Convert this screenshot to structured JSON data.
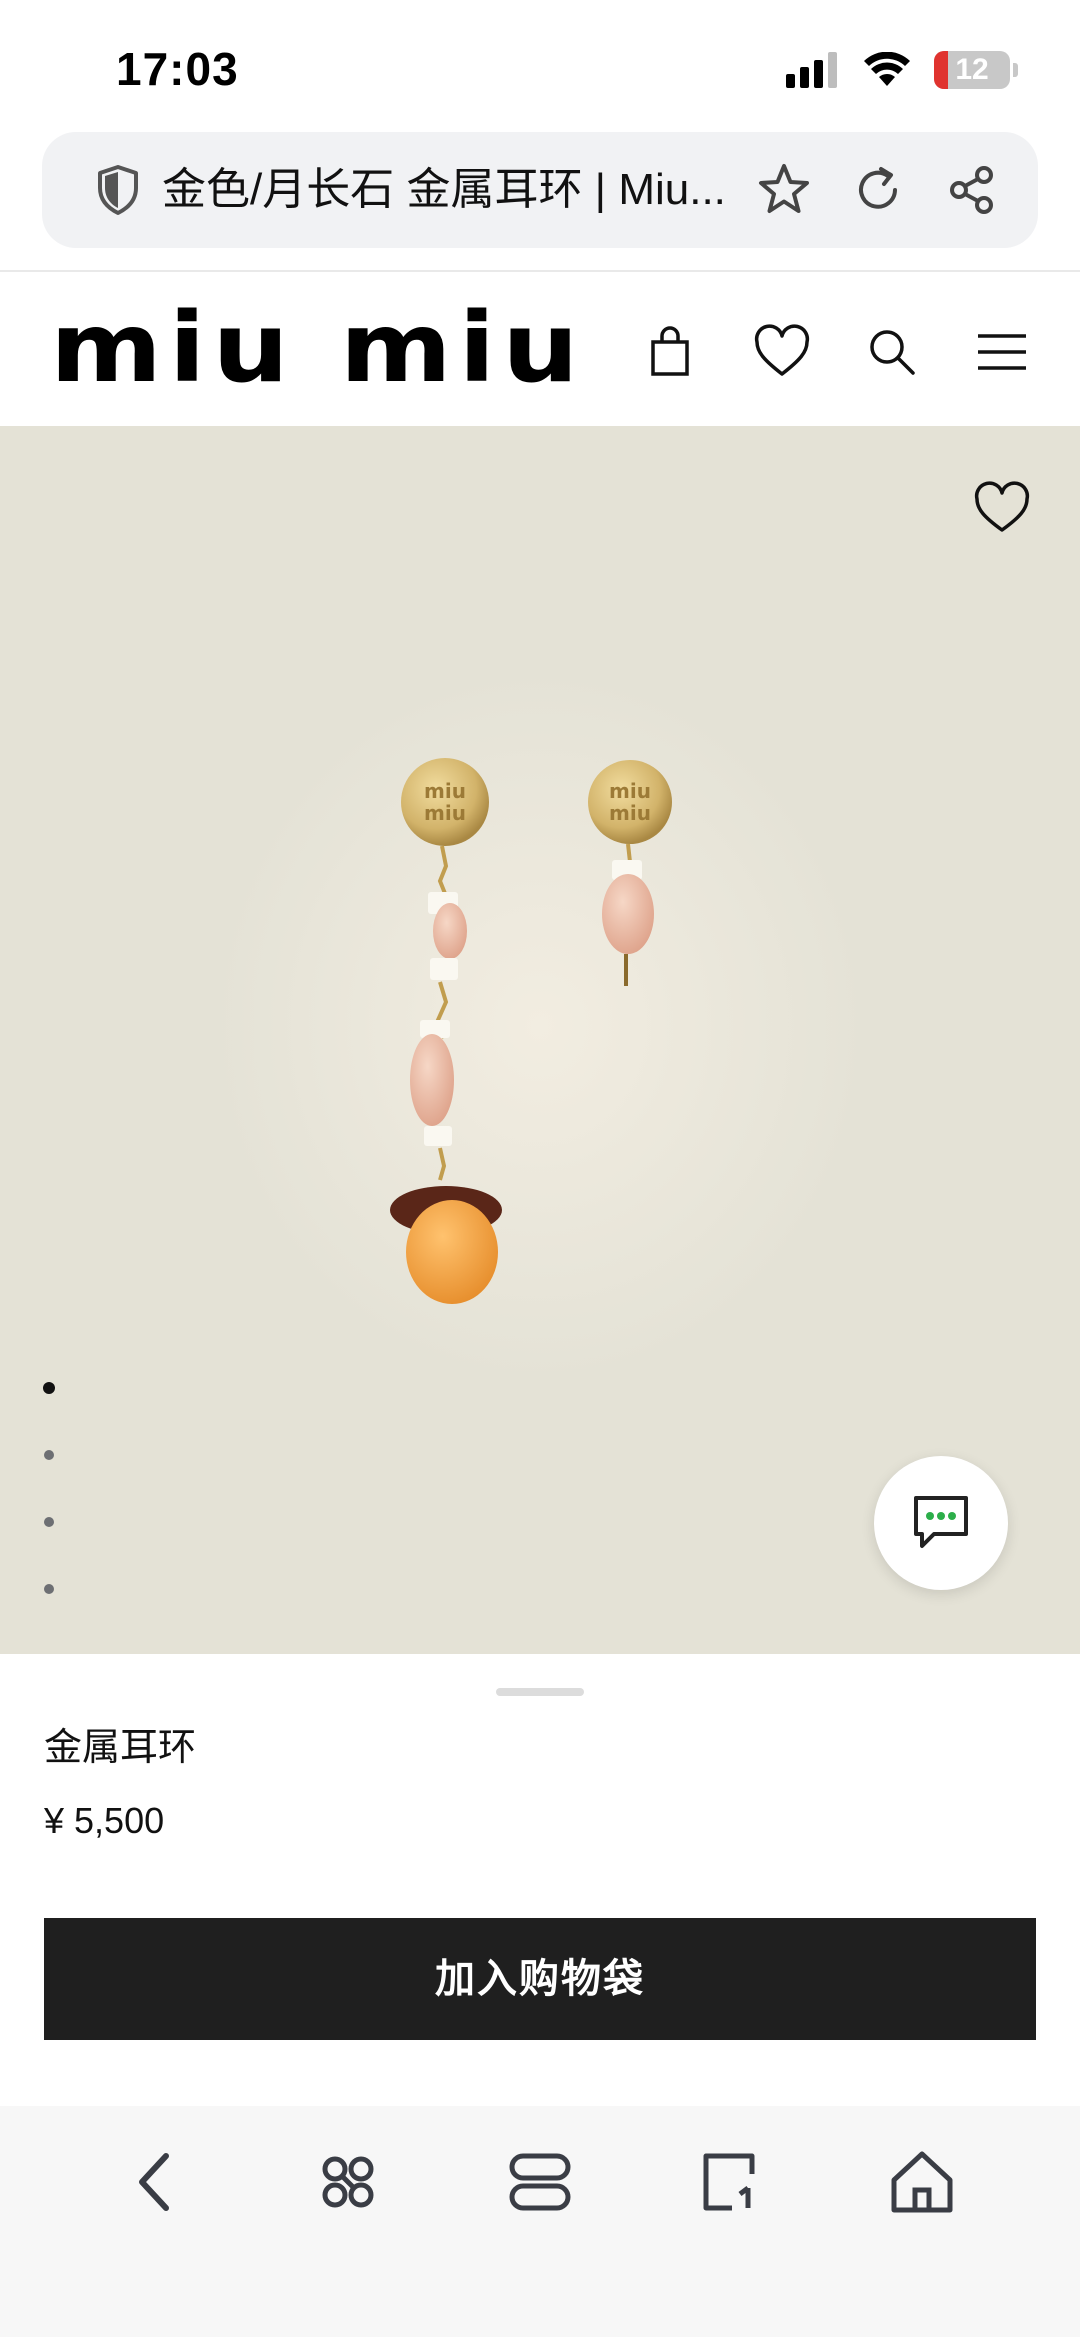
{
  "status_bar": {
    "time": "17:03",
    "battery_level": "12",
    "battery_color": "#e0332f",
    "icons": [
      "cellular-signal-icon",
      "wifi-icon",
      "battery-icon"
    ]
  },
  "browser": {
    "page_title": "金色/月长石 金属耳环 | Miu...",
    "icons": [
      "shield-icon",
      "star-icon",
      "reload-icon",
      "share-icon"
    ]
  },
  "site_header": {
    "logo_text": "miu miu",
    "icons": [
      "shopping-bag-icon",
      "heart-icon",
      "search-icon",
      "menu-icon"
    ]
  },
  "hero": {
    "background_color": "#e4e2d6",
    "image_subject": "earrings",
    "carousel": {
      "total": 4,
      "active_index": 0
    },
    "icons": [
      "favorite-heart-icon",
      "chat-icon"
    ]
  },
  "product": {
    "name": "金属耳环",
    "price": "¥ 5,500",
    "add_to_bag_label": "加入购物袋"
  },
  "toolbar": {
    "icons": [
      "back-icon",
      "apps-icon",
      "tabs-icon",
      "new-tab-icon",
      "home-icon"
    ]
  }
}
